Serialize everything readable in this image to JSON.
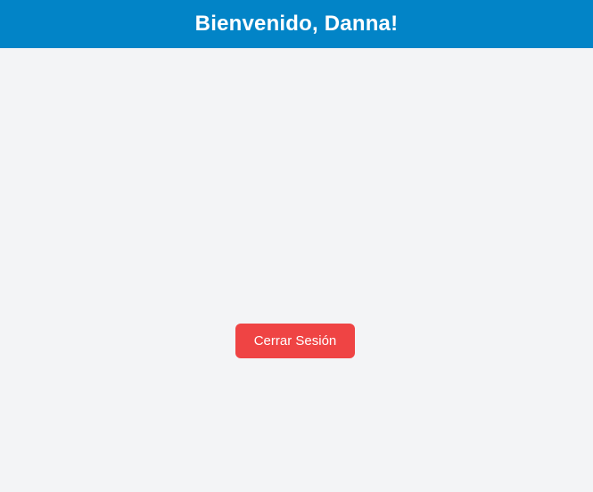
{
  "header": {
    "title": "Bienvenido, Danna!"
  },
  "main": {
    "logout_label": "Cerrar Sesión"
  },
  "colors": {
    "header_bg": "#0284c7",
    "page_bg": "#f3f4f6",
    "logout_bg": "#ef4444",
    "text_on_color": "#ffffff"
  }
}
